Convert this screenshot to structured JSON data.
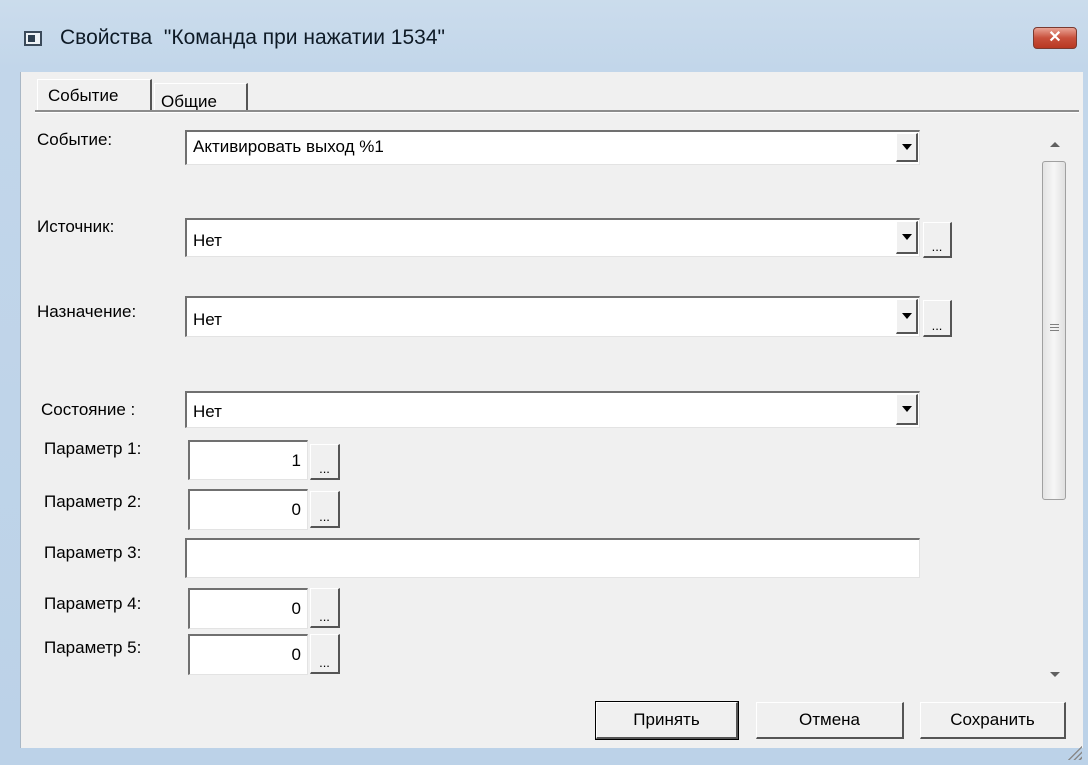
{
  "window": {
    "title": "Свойства  \"Команда при нажатии 1534\"",
    "close_glyph": "✕",
    "app_icon": "window-icon",
    "accent_close": "#c8503c"
  },
  "tabs": [
    {
      "label": "Событие",
      "active": true
    },
    {
      "label": "Общие",
      "active": false
    }
  ],
  "form": {
    "event": {
      "label": "Событие:",
      "value": "Активировать выход %1"
    },
    "source": {
      "label": "Источник:",
      "value": "Нет"
    },
    "destination": {
      "label": "Назначение:",
      "value": "Нет"
    },
    "state": {
      "label": "Состояние :",
      "value": "Нет"
    },
    "params": [
      {
        "label": "Параметр 1:",
        "value": "1"
      },
      {
        "label": "Параметр 2:",
        "value": "0"
      },
      {
        "label": "Параметр 3:",
        "value": ""
      },
      {
        "label": "Параметр 4:",
        "value": "0"
      },
      {
        "label": "Параметр 5:",
        "value": "0"
      }
    ],
    "browse_glyph": "..."
  },
  "buttons": {
    "accept": "Принять",
    "cancel": "Отмена",
    "save": "Сохранить"
  }
}
